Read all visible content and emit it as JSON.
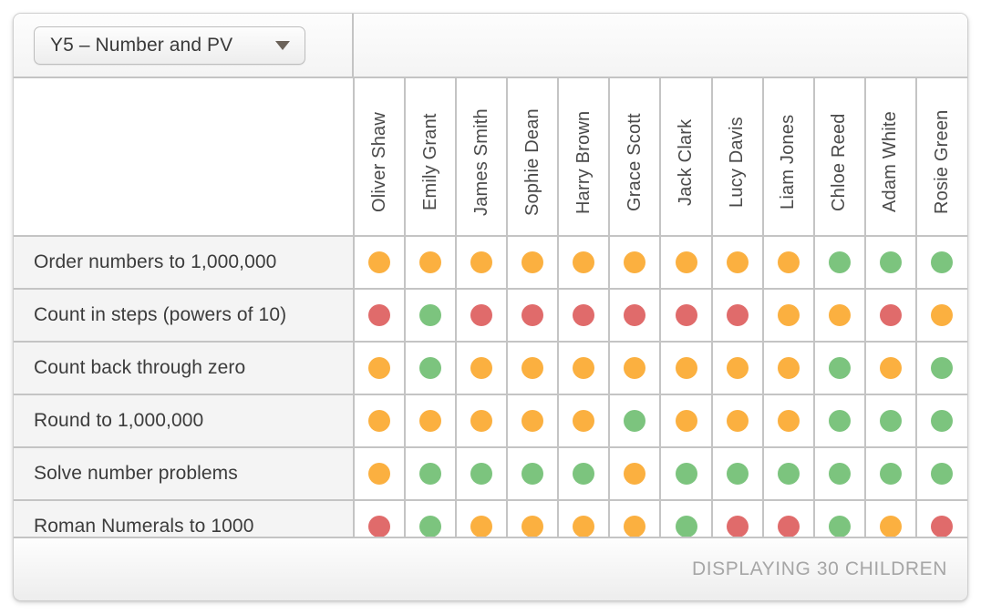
{
  "toolbar": {
    "class_selector": {
      "value": "Y5 – Number and PV",
      "caret_icon": "chevron-down-icon"
    }
  },
  "grid": {
    "students": [
      "Oliver Shaw",
      "Emily Grant",
      "James Smith",
      "Sophie Dean",
      "Harry Brown",
      "Grace Scott",
      "Jack Clark",
      "Lucy Davis",
      "Liam Jones",
      "Chloe Reed",
      "Adam White",
      "Rosie Green"
    ],
    "objectives": [
      "Order numbers to 1,000,000",
      "Count in steps (powers of 10)",
      "Count back through zero",
      "Round to 1,000,000",
      "Solve number problems",
      "Roman Numerals to 1000"
    ],
    "status_colors": {
      "green": "#7cc47e",
      "amber": "#fbb040",
      "red": "#e06b6b"
    },
    "ratings": [
      [
        "amber",
        "amber",
        "amber",
        "amber",
        "amber",
        "amber",
        "amber",
        "amber",
        "amber",
        "green",
        "green",
        "green"
      ],
      [
        "red",
        "green",
        "red",
        "red",
        "red",
        "red",
        "red",
        "red",
        "amber",
        "amber",
        "red",
        "amber"
      ],
      [
        "amber",
        "green",
        "amber",
        "amber",
        "amber",
        "amber",
        "amber",
        "amber",
        "amber",
        "green",
        "amber",
        "green"
      ],
      [
        "amber",
        "amber",
        "amber",
        "amber",
        "amber",
        "green",
        "amber",
        "amber",
        "amber",
        "green",
        "green",
        "green"
      ],
      [
        "amber",
        "green",
        "green",
        "green",
        "green",
        "amber",
        "green",
        "green",
        "green",
        "green",
        "green",
        "green"
      ],
      [
        "red",
        "green",
        "amber",
        "amber",
        "amber",
        "amber",
        "green",
        "red",
        "red",
        "green",
        "amber",
        "red"
      ]
    ]
  },
  "footer": {
    "count_text": "DISPLAYING 30 CHILDREN"
  }
}
